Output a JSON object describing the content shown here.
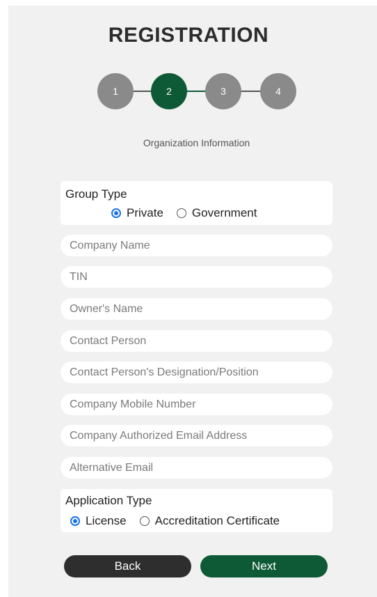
{
  "title": "REGISTRATION",
  "stepper": {
    "steps": [
      "1",
      "2",
      "3",
      "4"
    ],
    "active_step": 2,
    "caption": "Organization Information"
  },
  "group_type": {
    "label": "Group Type",
    "options": [
      "Private",
      "Government"
    ],
    "selected": "Private"
  },
  "fields": [
    {
      "placeholder": "Company Name",
      "value": ""
    },
    {
      "placeholder": "TIN",
      "value": ""
    },
    {
      "placeholder": "Owner's Name",
      "value": ""
    },
    {
      "placeholder": "Contact Person",
      "value": ""
    },
    {
      "placeholder": "Contact Person's Designation/Position",
      "value": ""
    },
    {
      "placeholder": "Company Mobile Number",
      "value": ""
    },
    {
      "placeholder": "Company Authorized Email Address",
      "value": ""
    },
    {
      "placeholder": "Alternative Email",
      "value": ""
    }
  ],
  "application_type": {
    "label": "Application Type",
    "options": [
      "License",
      "Accreditation Certificate"
    ],
    "selected": "License"
  },
  "buttons": {
    "back": "Back",
    "next": "Next"
  },
  "colors": {
    "accent": "#0f5a36",
    "inactive_step": "#8a8a8a",
    "radio_checked": "#1a73e8",
    "back_button": "#2e2e2e"
  }
}
